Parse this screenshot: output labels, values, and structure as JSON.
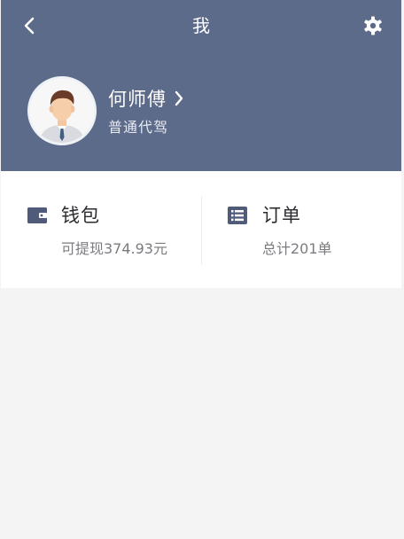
{
  "header": {
    "title": "我",
    "back_icon": "chevron-left-icon",
    "settings_icon": "gear-icon",
    "background": "#5c6b8a"
  },
  "profile": {
    "name": "何师傅",
    "role": "普通代驾",
    "avatar_icon": "driver-avatar",
    "chevron_icon": "chevron-right-icon"
  },
  "cards": {
    "wallet": {
      "icon": "wallet-icon",
      "title": "钱包",
      "subtitle": "可提现374.93元"
    },
    "orders": {
      "icon": "order-list-icon",
      "title": "订单",
      "subtitle": "总计201单"
    }
  }
}
